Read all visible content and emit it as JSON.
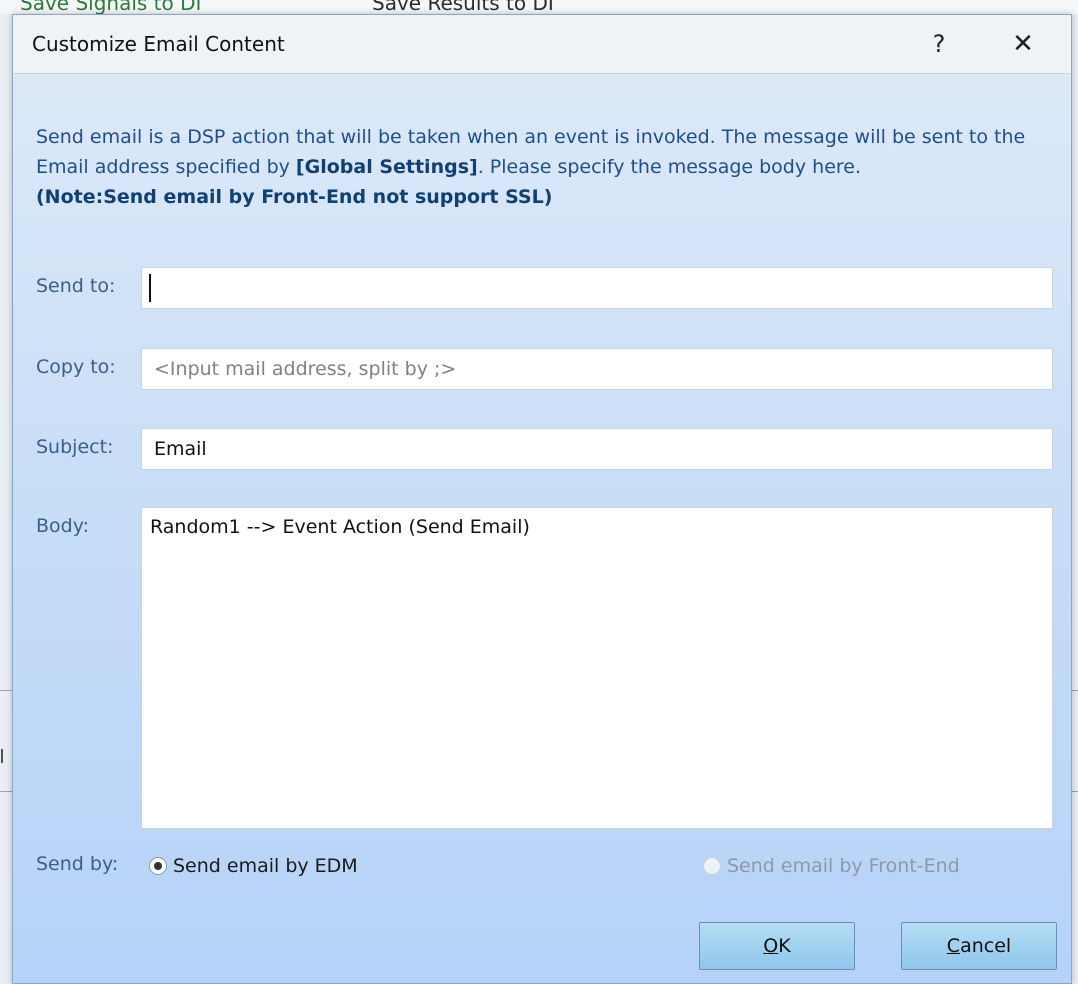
{
  "background": {
    "item1": "Save Signals to DI",
    "item2": "Save Results to DI"
  },
  "dialog": {
    "title": "Customize Email Content",
    "help_label": "?",
    "close_label": "✕"
  },
  "description": {
    "part1": "Send email is a DSP action that will be taken when an event is invoked. The message will be sent to the Email address specified by ",
    "bold_link": "[Global Settings]",
    "part2": ". Please specify the message body here.",
    "note": "(Note:Send email by Front-End not support SSL)"
  },
  "form": {
    "send_to": {
      "label": "Send to:",
      "value": ""
    },
    "copy_to": {
      "label": "Copy to:",
      "value": "",
      "placeholder": "<Input mail address, split by ;>"
    },
    "subject": {
      "label": "Subject:",
      "value": "Email"
    },
    "body": {
      "label": "Body:",
      "value": "Random1 --> Event Action (Send Email)"
    },
    "send_by": {
      "label": "Send by:",
      "options": [
        {
          "label": "Send email by EDM",
          "selected": true,
          "enabled": true
        },
        {
          "label": "Send email by Front-End",
          "selected": false,
          "enabled": false
        }
      ]
    }
  },
  "buttons": {
    "ok": {
      "mnemonic": "O",
      "rest": "K"
    },
    "cancel": {
      "mnemonic": "C",
      "rest": "ancel"
    }
  }
}
